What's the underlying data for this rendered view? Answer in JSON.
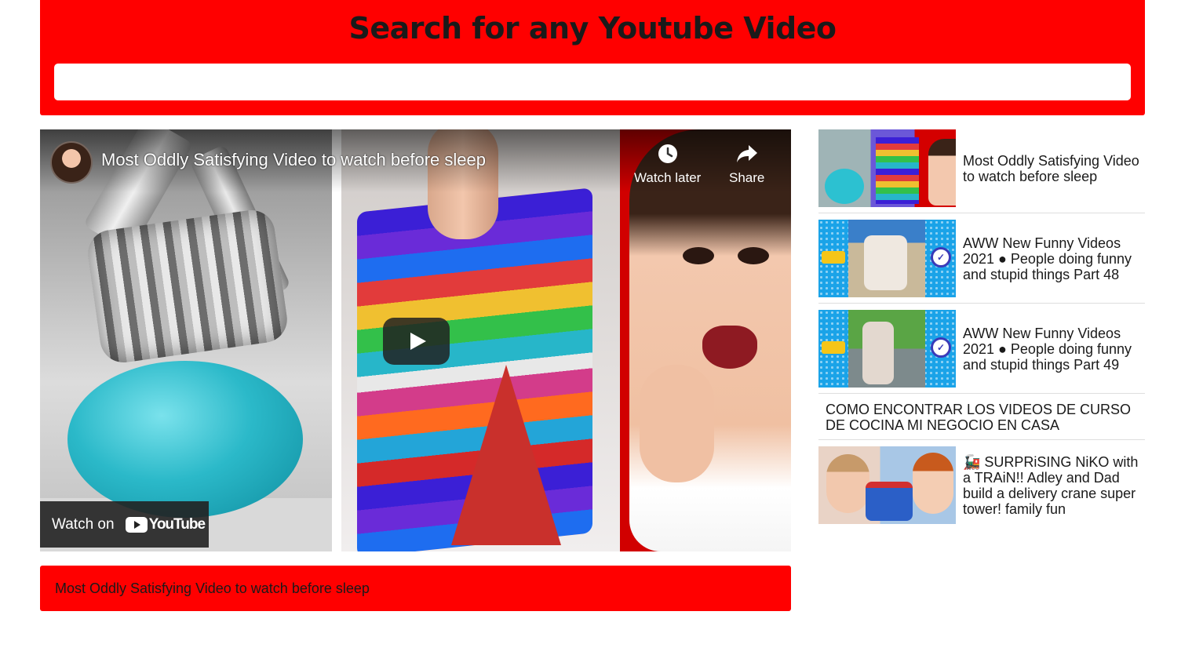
{
  "header": {
    "title": "Search for any Youtube Video",
    "search_placeholder": "",
    "search_value": ""
  },
  "player": {
    "video_title": "Most Oddly Satisfying Video to watch before sleep",
    "watch_later_label": "Watch later",
    "share_label": "Share",
    "watch_on_label": "Watch on",
    "youtube_wordmark": "YouTube"
  },
  "caption": "Most Oddly Satisfying Video to watch before sleep",
  "results": [
    {
      "title": "Most Oddly Satisfying Video to watch before sleep",
      "has_thumb": true
    },
    {
      "title": "AWW New Funny Videos 2021 ● People doing funny and stupid things Part 48",
      "has_thumb": true
    },
    {
      "title": "AWW New Funny Videos 2021 ● People doing funny and stupid things Part 49",
      "has_thumb": true
    },
    {
      "title": "COMO ENCONTRAR LOS VIDEOS DE CURSO DE COCINA MI NEGOCIO EN CASA",
      "has_thumb": false
    },
    {
      "title": "🚂 SURPRiSING NiKO with a TRAiN!! Adley and Dad build a delivery crane super tower! family fun",
      "has_thumb": true
    }
  ],
  "colors": {
    "brand_red": "#ff0000",
    "text_dark": "#1a1a1a"
  },
  "icons": [
    "clock-icon",
    "share-arrow-icon",
    "play-icon",
    "youtube-logo-icon"
  ]
}
